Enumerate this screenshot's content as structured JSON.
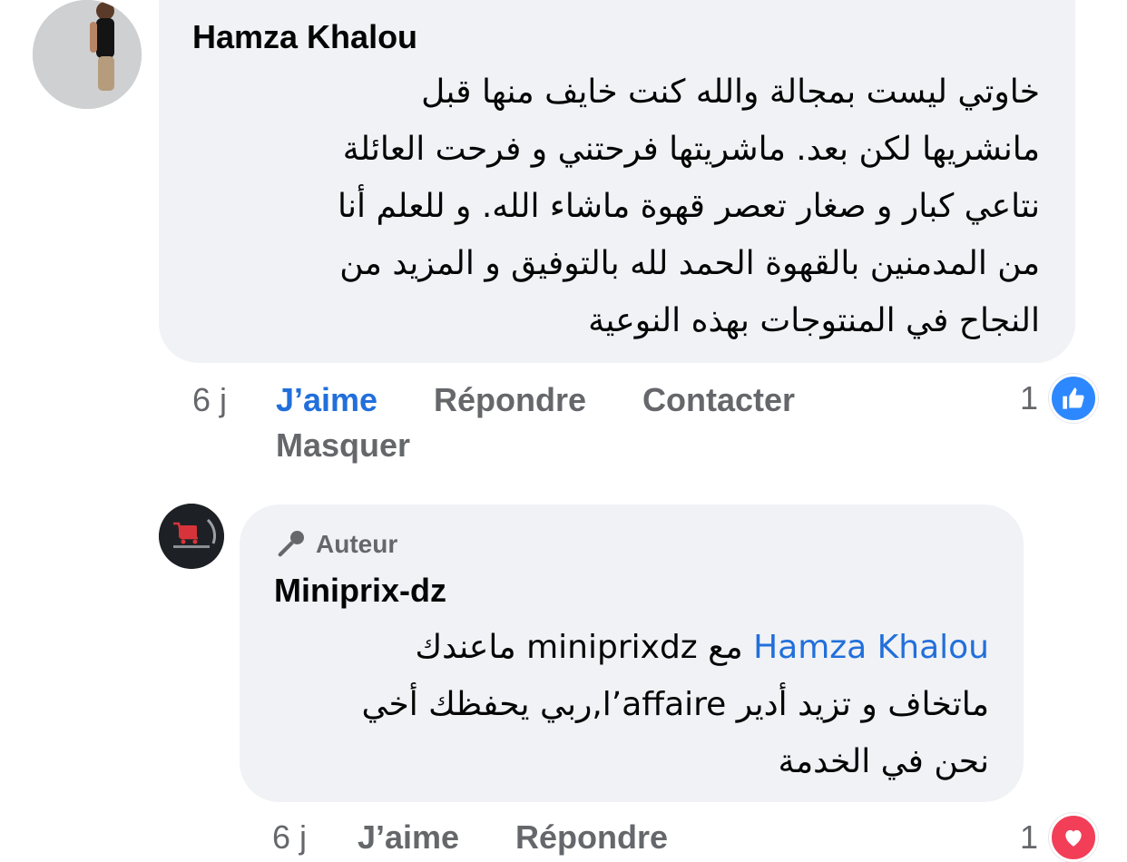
{
  "comments": [
    {
      "author": "Hamza Khalou",
      "text_lines": [
        "خاوتي ليست بمجالة والله  كنت خايف  منها قبل",
        "مانشريها لكن بعد. ماشريتها  فرحتني و فرحت العائلة",
        "نتاعي كبار و صغار    تعصر قهوة  ماشاء الله. و للعلم أنا",
        "من المدمنين بالقهوة الحمد لله  بالتوفيق  و المزيد من",
        "النجاح في المنتوجات بهذه النوعية"
      ],
      "time": "6 j",
      "actions": {
        "like": "J’aime",
        "reply": "Répondre",
        "contact": "Contacter",
        "hide": "Masquer"
      },
      "reaction": {
        "count": "1",
        "type": "like-icon",
        "color": "#2d88ff"
      },
      "liked_color": "#216fdb"
    },
    {
      "badge": "Auteur",
      "author": "Miniprix-dz",
      "mention": "Hamza Khalou",
      "line1_rest": " مع miniprixdz ماعندك",
      "text_lines": [
        "ماتخاف و تزيد أدير l’affaire,ربي يحفظك أخي",
        "نحن في الخدمة"
      ],
      "time": "6 j",
      "actions": {
        "like": "J’aime",
        "reply": "Répondre"
      },
      "reaction": {
        "count": "1",
        "type": "heart-icon",
        "color": "#f33e58"
      }
    }
  ],
  "colors": {
    "bubble": "#f0f2f5",
    "secondary_text": "#65676b",
    "link": "#216fdb"
  }
}
